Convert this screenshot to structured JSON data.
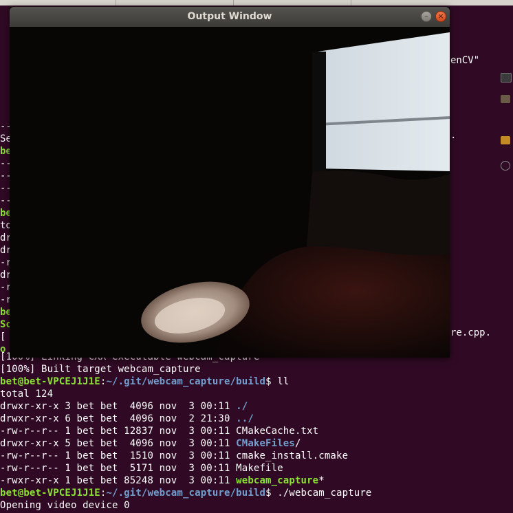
{
  "window": {
    "title": "Output Window",
    "minimize_glyph": "–",
    "close_glyph": "×"
  },
  "terminal_partials": {
    "top_right": "enCV\"",
    "cpp_tail": "re.cpp.",
    "mid_right": "."
  },
  "left_fragments": [
    "--",
    "Se",
    "be",
    "--",
    "--",
    "--",
    "--",
    "be",
    "to",
    "dr",
    "dr",
    "-r",
    "dr",
    "-r",
    "-r",
    "be",
    "Sc",
    "[",
    "o"
  ],
  "terminal_lines": [
    {
      "kind": "plain",
      "text": "[100%] Linking CXX executable webcam_capture"
    },
    {
      "kind": "plain",
      "text": "[100%] Built target webcam_capture"
    },
    {
      "kind": "prompt",
      "user": "bet@bet-VPCEJ1J1E",
      "sep": ":",
      "path": "~/.git/webcam_capture/build",
      "cmd": "$ ll"
    },
    {
      "kind": "plain",
      "text": "total 124"
    },
    {
      "kind": "entry",
      "meta": "drwxr-xr-x 3 bet bet  4096 nov  3 00:11 ",
      "name": "./",
      "style": "blue"
    },
    {
      "kind": "entry",
      "meta": "drwxr-xr-x 6 bet bet  4096 nov  2 21:30 ",
      "name": "../",
      "style": "blue"
    },
    {
      "kind": "entry",
      "meta": "-rw-r--r-- 1 bet bet 12837 nov  3 00:11 ",
      "name": "CMakeCache.txt",
      "style": "white"
    },
    {
      "kind": "entry",
      "meta": "drwxr-xr-x 5 bet bet  4096 nov  3 00:11 ",
      "name": "CMakeFiles",
      "suffix": "/",
      "style": "blue"
    },
    {
      "kind": "entry",
      "meta": "-rw-r--r-- 1 bet bet  1510 nov  3 00:11 ",
      "name": "cmake_install.cmake",
      "style": "white"
    },
    {
      "kind": "entry",
      "meta": "-rw-r--r-- 1 bet bet  5171 nov  3 00:11 ",
      "name": "Makefile",
      "style": "white"
    },
    {
      "kind": "entry",
      "meta": "-rwxr-xr-x 1 bet bet 85248 nov  3 00:11 ",
      "name": "webcam_capture",
      "suffix": "*",
      "style": "green"
    },
    {
      "kind": "prompt",
      "user": "bet@bet-VPCEJ1J1E",
      "sep": ":",
      "path": "~/.git/webcam_capture/build",
      "cmd": "$ ./webcam_capture"
    },
    {
      "kind": "plain",
      "text": "Opening video device 0"
    }
  ],
  "colors": {
    "terminal_bg": "#300a24",
    "prompt_user": "#8ae234",
    "prompt_path": "#729fcf",
    "titlebar": "#3c3b37",
    "close_button": "#e05a28"
  }
}
